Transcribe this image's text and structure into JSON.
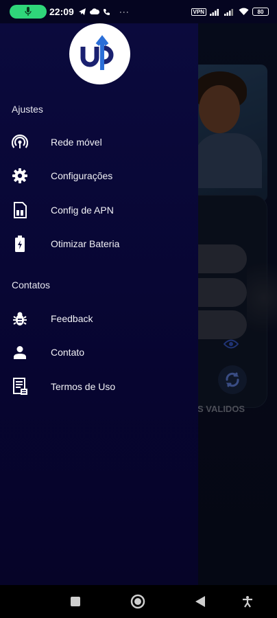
{
  "status_bar": {
    "time": "22:09",
    "vpn": "VPN",
    "battery": "80",
    "icons": [
      "mic-icon",
      "telegram-icon",
      "cloud-icon",
      "phone-icon",
      "more-icon",
      "signal-icon",
      "wifi-icon",
      "battery-icon"
    ]
  },
  "background": {
    "validos_text": "S VALIDOS"
  },
  "drawer": {
    "logo_text": "up",
    "sections": {
      "ajustes": "Ajustes",
      "contatos": "Contatos"
    },
    "items": [
      {
        "label": "Rede móvel",
        "icon": "wireless-icon"
      },
      {
        "label": "Configurações",
        "icon": "gear-icon"
      },
      {
        "label": "Config de APN",
        "icon": "sim-card-icon"
      },
      {
        "label": "Otimizar Bateria",
        "icon": "battery-charging-icon"
      },
      {
        "label": "Feedback",
        "icon": "bug-icon"
      },
      {
        "label": "Contato",
        "icon": "person-icon"
      },
      {
        "label": "Termos de Uso",
        "icon": "document-icon"
      }
    ]
  },
  "nav_bar": {
    "icons": [
      "recents-square-icon",
      "home-circle-icon",
      "back-triangle-icon",
      "accessibility-icon"
    ]
  }
}
